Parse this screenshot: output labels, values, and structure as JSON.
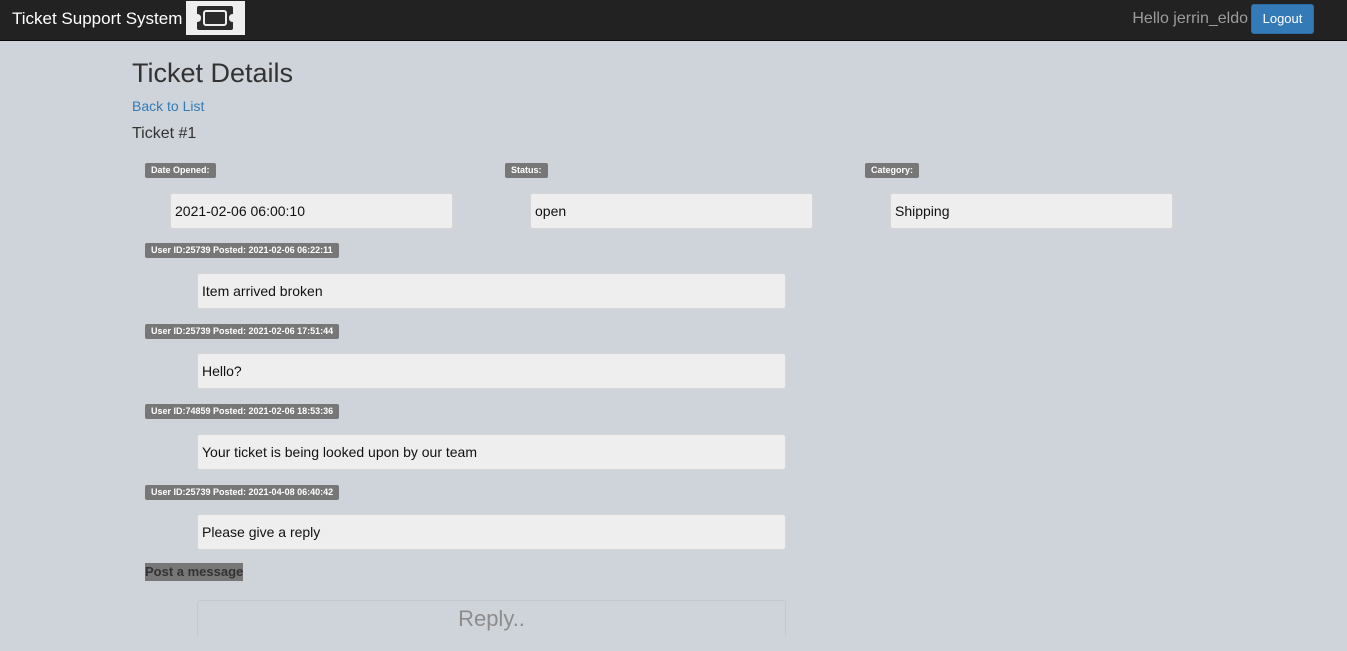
{
  "navbar": {
    "brand": "Ticket Support System",
    "logo_icon": "ticket-icon",
    "greeting": "Hello jerrin_eldo",
    "logout_label": "Logout"
  },
  "page": {
    "title": "Ticket Details",
    "back_link": "Back to List",
    "ticket_number": "Ticket #1"
  },
  "ticket": {
    "date_opened_label": "Date Opened:",
    "date_opened": "2021-02-06 06:00:10",
    "status_label": "Status:",
    "status": "open",
    "category_label": "Category:",
    "category": "Shipping"
  },
  "messages": [
    {
      "header": "User ID:25739 Posted: 2021-02-06 06:22:11",
      "text": "Item arrived broken"
    },
    {
      "header": "User ID:25739 Posted: 2021-02-06 17:51:44",
      "text": "Hello?"
    },
    {
      "header": "User ID:74859 Posted: 2021-02-06 18:53:36",
      "text": "Your ticket is being looked upon by our team"
    },
    {
      "header": "User ID:25739 Posted: 2021-04-08 06:40:42",
      "text": "Please give a reply"
    }
  ],
  "reply": {
    "section_label": "Post a message",
    "placeholder": "Reply.."
  },
  "colors": {
    "background": "#cfd4db",
    "navbar": "#222222",
    "primary": "#337ab7",
    "tag": "#777777",
    "field": "#eeeeee"
  }
}
